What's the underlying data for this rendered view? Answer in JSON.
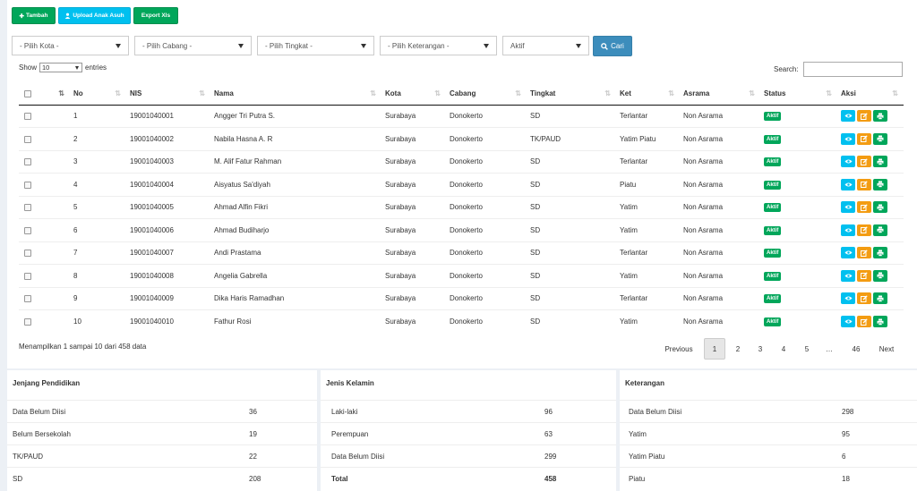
{
  "toolbar": {
    "tambah_label": "Tambah",
    "upload_label": "Upload Anak Asuh",
    "export_label": "Export Xls"
  },
  "filters": {
    "kota": "- Pilih Kota -",
    "cabang": "- Pilih Cabang -",
    "tingkat": "- Pilih Tingkat -",
    "keterangan": "- Pilih Keterangan -",
    "status": "Aktif",
    "cari_label": "Cari"
  },
  "table_controls": {
    "show_label": "Show",
    "page_length": "10",
    "entries_label": "entries",
    "search_label": "Search:",
    "search_value": ""
  },
  "columns": [
    "No",
    "NIS",
    "Nama",
    "Kota",
    "Cabang",
    "Tingkat",
    "Ket",
    "Asrama",
    "Status",
    "Aksi"
  ],
  "rows": [
    {
      "no": "1",
      "nis": "19001040001",
      "nama": "Angger Tri Putra S.",
      "kota": "Surabaya",
      "cabang": "Donokerto",
      "tingkat": "SD",
      "ket": "Terlantar",
      "asrama": "Non Asrama",
      "status": "Aktif"
    },
    {
      "no": "2",
      "nis": "19001040002",
      "nama": "Nabila Hasna A. R",
      "kota": "Surabaya",
      "cabang": "Donokerto",
      "tingkat": "TK/PAUD",
      "ket": "Yatim Piatu",
      "asrama": "Non Asrama",
      "status": "Aktif"
    },
    {
      "no": "3",
      "nis": "19001040003",
      "nama": "M. Alif Fatur Rahman",
      "kota": "Surabaya",
      "cabang": "Donokerto",
      "tingkat": "SD",
      "ket": "Terlantar",
      "asrama": "Non Asrama",
      "status": "Aktif"
    },
    {
      "no": "4",
      "nis": "19001040004",
      "nama": "Aisyatus Sa'diyah",
      "kota": "Surabaya",
      "cabang": "Donokerto",
      "tingkat": "SD",
      "ket": "Piatu",
      "asrama": "Non Asrama",
      "status": "Aktif"
    },
    {
      "no": "5",
      "nis": "19001040005",
      "nama": "Ahmad Alfin Fikri",
      "kota": "Surabaya",
      "cabang": "Donokerto",
      "tingkat": "SD",
      "ket": "Yatim",
      "asrama": "Non Asrama",
      "status": "Aktif"
    },
    {
      "no": "6",
      "nis": "19001040006",
      "nama": "Ahmad Budiharjo",
      "kota": "Surabaya",
      "cabang": "Donokerto",
      "tingkat": "SD",
      "ket": "Yatim",
      "asrama": "Non Asrama",
      "status": "Aktif"
    },
    {
      "no": "7",
      "nis": "19001040007",
      "nama": "Andi Prastama",
      "kota": "Surabaya",
      "cabang": "Donokerto",
      "tingkat": "SD",
      "ket": "Terlantar",
      "asrama": "Non Asrama",
      "status": "Aktif"
    },
    {
      "no": "8",
      "nis": "19001040008",
      "nama": "Angelia Gabrella",
      "kota": "Surabaya",
      "cabang": "Donokerto",
      "tingkat": "SD",
      "ket": "Yatim",
      "asrama": "Non Asrama",
      "status": "Aktif"
    },
    {
      "no": "9",
      "nis": "19001040009",
      "nama": "Dika Haris Ramadhan",
      "kota": "Surabaya",
      "cabang": "Donokerto",
      "tingkat": "SD",
      "ket": "Terlantar",
      "asrama": "Non Asrama",
      "status": "Aktif"
    },
    {
      "no": "10",
      "nis": "19001040010",
      "nama": "Fathur Rosi",
      "kota": "Surabaya",
      "cabang": "Donokerto",
      "tingkat": "SD",
      "ket": "Yatim",
      "asrama": "Non Asrama",
      "status": "Aktif"
    }
  ],
  "info_text": "Menampilkan 1 sampai 10 dari 458 data",
  "pagination": {
    "previous": "Previous",
    "pages": [
      "1",
      "2",
      "3",
      "4",
      "5",
      "…",
      "46"
    ],
    "active": "1",
    "next": "Next"
  },
  "panels": {
    "jenjang": {
      "title": "Jenjang Pendidikan",
      "rows": [
        {
          "label": "Data Belum Diisi",
          "value": "36"
        },
        {
          "label": "Belum Bersekolah",
          "value": "19"
        },
        {
          "label": "TK/PAUD",
          "value": "22"
        },
        {
          "label": "SD",
          "value": "208"
        }
      ]
    },
    "kelamin": {
      "title": "Jenis Kelamin",
      "rows": [
        {
          "label": "Laki-laki",
          "value": "96"
        },
        {
          "label": "Perempuan",
          "value": "63"
        },
        {
          "label": "Data Belum Diisi",
          "value": "299"
        },
        {
          "label": "Total",
          "value": "458"
        }
      ]
    },
    "keterangan": {
      "title": "Keterangan",
      "rows": [
        {
          "label": "Data Belum Diisi",
          "value": "298"
        },
        {
          "label": "Yatim",
          "value": "95"
        },
        {
          "label": "Yatim Piatu",
          "value": "6"
        },
        {
          "label": "Piatu",
          "value": "18"
        }
      ]
    }
  },
  "colors": {
    "green": "#00a65a",
    "blue": "#00c0ef",
    "orange": "#f39c12",
    "primary": "#3c8dbc"
  }
}
